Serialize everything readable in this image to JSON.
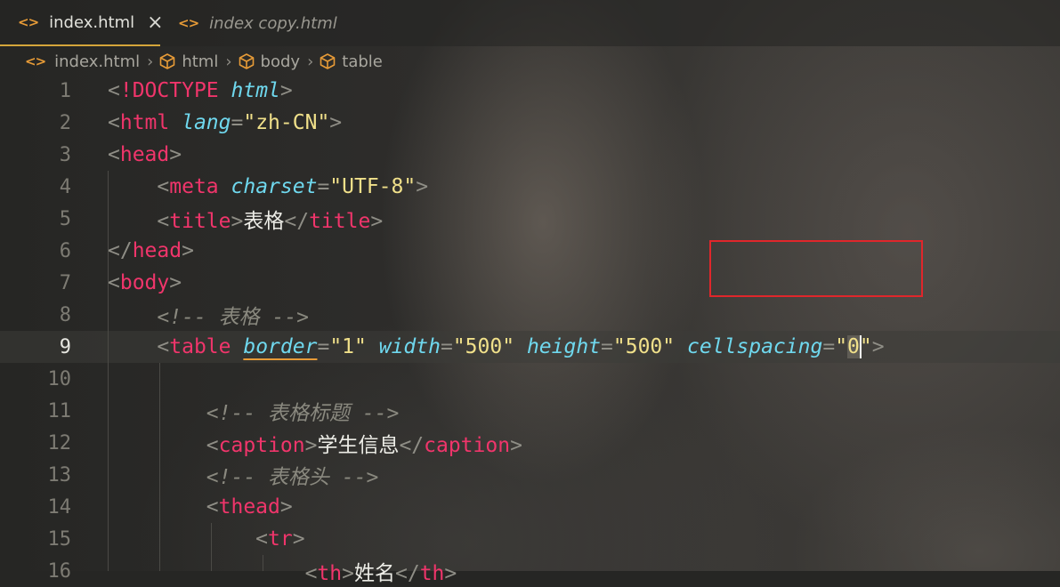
{
  "tabs": [
    {
      "label": "index.html",
      "icon": "code-file-icon",
      "active": true,
      "close": "×"
    },
    {
      "label": "index copy.html",
      "icon": "code-file-icon",
      "active": false
    }
  ],
  "breadcrumb": [
    "index.html",
    "html",
    "body",
    "table"
  ],
  "colors": {
    "accent": "#e79b37",
    "tag": "#f0356b",
    "attribute": "#6fd8ee",
    "string": "#f0e08a",
    "comment": "#8a897f",
    "highlight_box": "#e0262b"
  },
  "editor": {
    "current_line": 9,
    "lines": [
      {
        "n": "1"
      },
      {
        "n": "2"
      },
      {
        "n": "3"
      },
      {
        "n": "4"
      },
      {
        "n": "5"
      },
      {
        "n": "6"
      },
      {
        "n": "7"
      },
      {
        "n": "8"
      },
      {
        "n": "9"
      },
      {
        "n": "10"
      },
      {
        "n": "11"
      },
      {
        "n": "12"
      },
      {
        "n": "13"
      },
      {
        "n": "14"
      },
      {
        "n": "15"
      },
      {
        "n": "16"
      }
    ],
    "tokens": {
      "doctype": "!DOCTYPE",
      "html_kw": "html",
      "html": "html",
      "lang": "lang",
      "lang_val": "\"zh-CN\"",
      "head": "head",
      "meta": "meta",
      "charset": "charset",
      "charset_val": "\"UTF-8\"",
      "title": "title",
      "title_text": "表格",
      "body": "body",
      "comment_table": "<!-- 表格 -->",
      "table": "table",
      "border": "border",
      "border_val": "\"1\"",
      "width": "width",
      "width_val": "\"500\"",
      "height": "height",
      "height_val": "\"500\"",
      "cellspacing": "cellspacing",
      "cellspacing_val_open": "\"",
      "cellspacing_val_digit": "0",
      "cellspacing_val_close": "\"",
      "comment_caption": "<!-- 表格标题 -->",
      "caption": "caption",
      "caption_text": "学生信息",
      "comment_thead": "<!-- 表格头 -->",
      "thead": "thead",
      "tr": "tr",
      "th": "th",
      "th_text": "姓名"
    }
  }
}
